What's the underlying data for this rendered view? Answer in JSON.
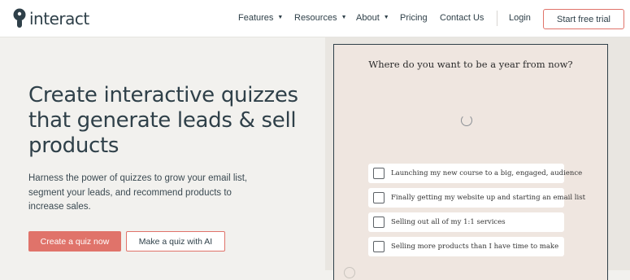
{
  "header": {
    "logo_text": "interact",
    "nav": [
      {
        "label": "Features",
        "caret": "▼"
      },
      {
        "label": "Resources",
        "caret": "▼"
      },
      {
        "label": "About",
        "caret": "▼"
      },
      {
        "label": "Pricing"
      },
      {
        "label": "Contact Us"
      }
    ],
    "login": "Login",
    "cta": "Start free trial"
  },
  "hero": {
    "title": "Create interactive quizzes that generate leads & sell products",
    "subtitle": "Harness the power of quizzes to grow your email list, segment your leads, and recommend products to increase sales.",
    "primary_button": "Create a quiz now",
    "secondary_button": "Make a quiz with AI"
  },
  "quiz": {
    "question": "Where do you want to be a year from now?",
    "options": [
      "Launching my new course to a big, engaged, audience",
      "Finally getting my website up and starting an email list",
      "Selling out all of my 1:1 services",
      "Selling more products than I have time to make"
    ]
  },
  "colors": {
    "accent": "#e0736a",
    "text": "#2f4049",
    "quiz_bg": "#efe6e0"
  }
}
